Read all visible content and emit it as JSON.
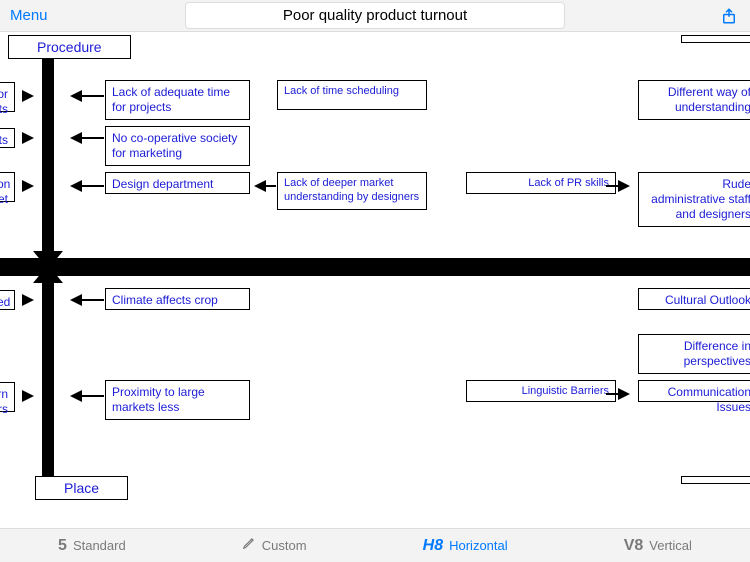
{
  "topbar": {
    "menu": "Menu",
    "title": "Poor quality product turnout"
  },
  "categories": {
    "procedure": "Procedure",
    "place": "Place"
  },
  "nodes": {
    "n_lefttop1": "or\nts",
    "n_lefttop2": "ts",
    "n_lefttop3": "on\net",
    "n_lack_time": "Lack of adequate time for projects",
    "n_no_coop": "No co-operative society for marketing",
    "n_design": "Design department",
    "n_time_sched": "Lack of time scheduling",
    "n_deeper": "Lack of deeper market understanding by designers",
    "n_pr": "Lack of PR skills",
    "n_diffway": "Different way of understanding",
    "n_rude": "Rude administrative staff and designers",
    "n_leftbot1": "ed",
    "n_leftbot2": "rn\nrs",
    "n_climate": "Climate affects crop",
    "n_proximity": "Proximity to large markets less",
    "n_ling": "Linguistic Barriers",
    "n_cultout": "Cultural Outlook",
    "n_diffpersp": "Difference in perspectives",
    "n_commissue": "Communication Issues"
  },
  "bottombar": {
    "standard": "Standard",
    "custom": "Custom",
    "horizontal": "Horizontal",
    "vertical": "Vertical"
  }
}
